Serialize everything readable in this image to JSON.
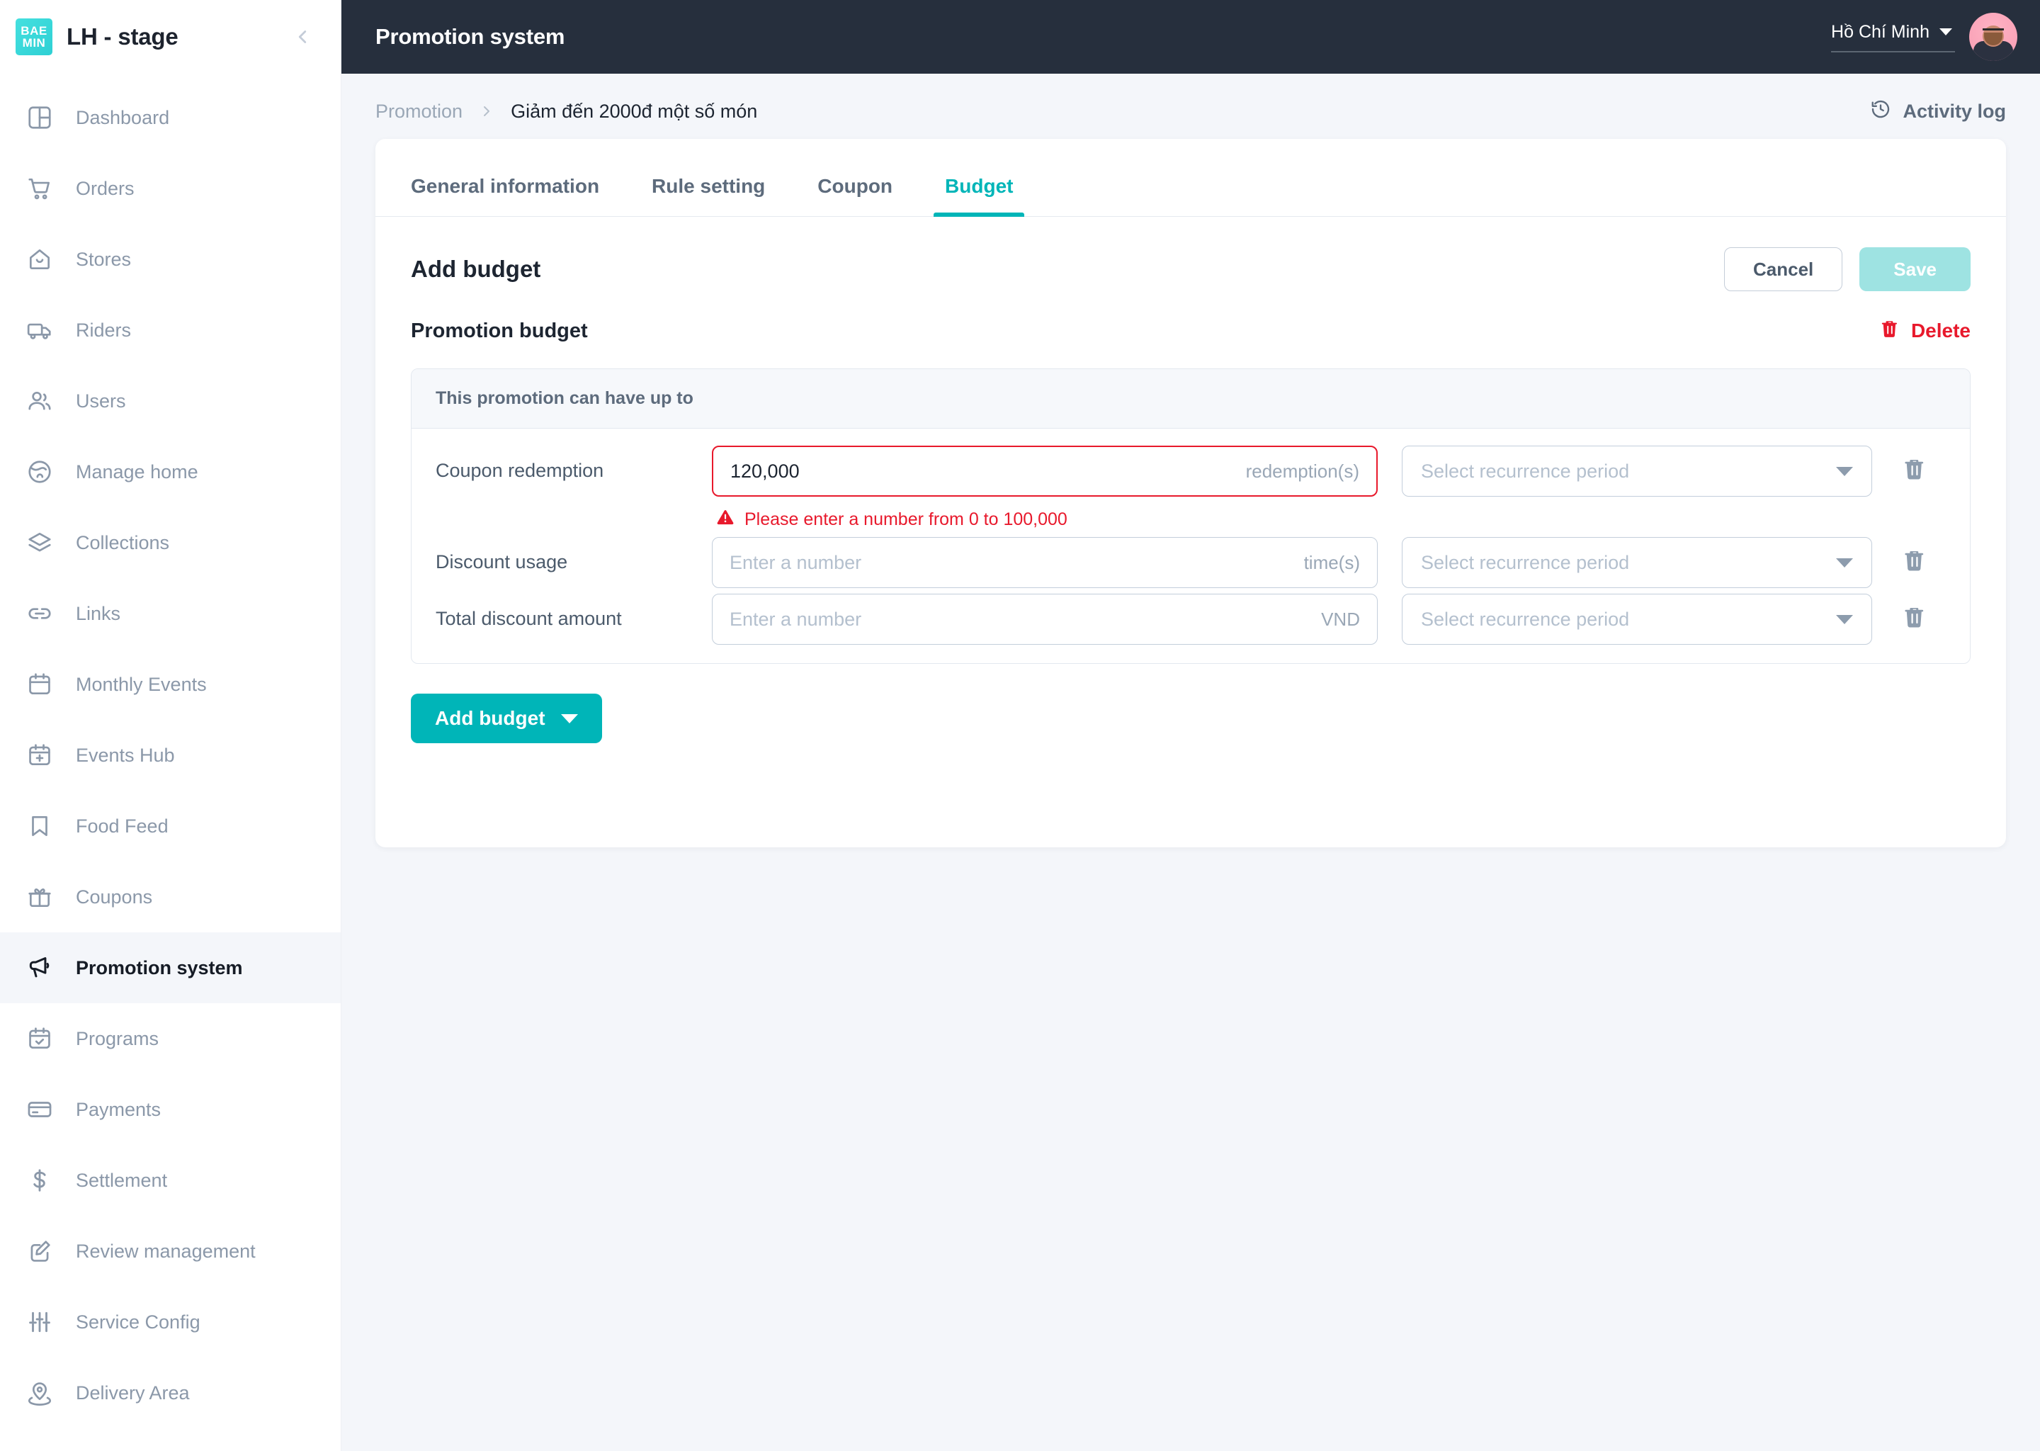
{
  "brand": {
    "logo_text_top": "BAE",
    "logo_text_bottom": "MIN",
    "title": "LH - stage",
    "logo_color": "#2ed0d4"
  },
  "sidebar": {
    "items": [
      {
        "label": "Dashboard",
        "icon": "dashboard-icon",
        "active": false
      },
      {
        "label": "Orders",
        "icon": "cart-icon",
        "active": false
      },
      {
        "label": "Stores",
        "icon": "store-icon",
        "active": false
      },
      {
        "label": "Riders",
        "icon": "truck-icon",
        "active": false
      },
      {
        "label": "Users",
        "icon": "users-icon",
        "active": false
      },
      {
        "label": "Manage home",
        "icon": "globe-icon",
        "active": false
      },
      {
        "label": "Collections",
        "icon": "layers-icon",
        "active": false
      },
      {
        "label": "Links",
        "icon": "link-icon",
        "active": false
      },
      {
        "label": "Monthly Events",
        "icon": "calendar-icon",
        "active": false
      },
      {
        "label": "Events Hub",
        "icon": "calendar-plus-icon",
        "active": false
      },
      {
        "label": "Food Feed",
        "icon": "bookmark-icon",
        "active": false
      },
      {
        "label": "Coupons",
        "icon": "gift-icon",
        "active": false
      },
      {
        "label": "Promotion system",
        "icon": "megaphone-icon",
        "active": true
      },
      {
        "label": "Programs",
        "icon": "calendar-check-icon",
        "active": false
      },
      {
        "label": "Payments",
        "icon": "card-icon",
        "active": false
      },
      {
        "label": "Settlement",
        "icon": "dollar-icon",
        "active": false
      },
      {
        "label": "Review management",
        "icon": "edit-square-icon",
        "active": false
      },
      {
        "label": "Service Config",
        "icon": "sliders-icon",
        "active": false
      },
      {
        "label": "Delivery Area",
        "icon": "map-pin-icon",
        "active": false
      }
    ]
  },
  "topbar": {
    "title": "Promotion system",
    "city": "Hồ Chí Minh",
    "avatar_bg": "#fba7bb"
  },
  "breadcrumb": {
    "parent": "Promotion",
    "current": "Giảm đến 2000đ một số món",
    "activity_log": "Activity log"
  },
  "tabs": [
    {
      "label": "General information",
      "active": false
    },
    {
      "label": "Rule setting",
      "active": false
    },
    {
      "label": "Coupon",
      "active": false
    },
    {
      "label": "Budget",
      "active": true
    }
  ],
  "budget": {
    "heading": "Add budget",
    "cancel_label": "Cancel",
    "save_label": "Save",
    "section_label": "Promotion budget",
    "delete_label": "Delete",
    "table_header": "This promotion can have up to",
    "add_budget_label": "Add budget",
    "recurrence_placeholder": "Select recurrence period",
    "rows": [
      {
        "label": "Coupon redemption",
        "value": "120,000",
        "placeholder": "Enter a number",
        "unit": "redemption(s)",
        "error": "Please enter a number from 0 to 100,000",
        "has_error": true,
        "recurrence": ""
      },
      {
        "label": "Discount usage",
        "value": "",
        "placeholder": "Enter a number",
        "unit": "time(s)",
        "error": "",
        "has_error": false,
        "recurrence": ""
      },
      {
        "label": "Total discount amount",
        "value": "",
        "placeholder": "Enter a number",
        "unit": "VND",
        "error": "",
        "has_error": false,
        "recurrence": ""
      }
    ]
  },
  "colors": {
    "accent": "#00b5b8",
    "danger": "#e8192c",
    "topbar_bg": "#262f3d",
    "page_bg": "#f4f6fa"
  }
}
